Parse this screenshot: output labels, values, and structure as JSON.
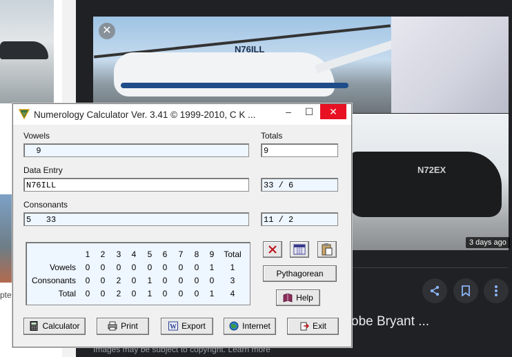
{
  "background": {
    "left_panel_text": "pte",
    "second_image_reg": "N72EX",
    "main_image_reg": "N76ILL",
    "time_badge": "3 days ago",
    "result_title": "obe Bryant ...",
    "footer": "Images may be subject to copyright.",
    "footer_link": "Learn more"
  },
  "window": {
    "title": "Numerology Calculator Ver. 3.41 © 1999-2010, C K ...",
    "minimize": "–",
    "maximize": "☐",
    "close": "✕"
  },
  "fields": {
    "vowels_label": "Vowels",
    "vowels_value": "  9",
    "totals_label": "Totals",
    "totals_value": "9",
    "data_entry_label": "Data Entry",
    "data_entry_value": "N76ILL",
    "data_entry_total": "33 / 6",
    "consonants_label": "Consonants",
    "consonants_value": "5   33",
    "consonants_total": "11 / 2"
  },
  "grid": {
    "headers": [
      "1",
      "2",
      "3",
      "4",
      "5",
      "6",
      "7",
      "8",
      "9",
      "Total"
    ],
    "rows": [
      {
        "label": "Vowels",
        "values": [
          "0",
          "0",
          "0",
          "0",
          "0",
          "0",
          "0",
          "0",
          "1",
          "1"
        ]
      },
      {
        "label": "Consonants",
        "values": [
          "0",
          "0",
          "2",
          "0",
          "1",
          "0",
          "0",
          "0",
          "0",
          "3"
        ]
      },
      {
        "label": "Total",
        "values": [
          "0",
          "0",
          "2",
          "0",
          "1",
          "0",
          "0",
          "0",
          "1",
          "4"
        ]
      }
    ]
  },
  "buttons": {
    "pythagorean": "Pythagorean",
    "help": "Help",
    "calculator": "Calculator",
    "print": "Print",
    "export": "Export",
    "internet": "Internet",
    "exit": "Exit"
  },
  "colors": {
    "field_bg": "#eef6ff",
    "close_red": "#e81123",
    "viewer_bg": "#202124"
  }
}
